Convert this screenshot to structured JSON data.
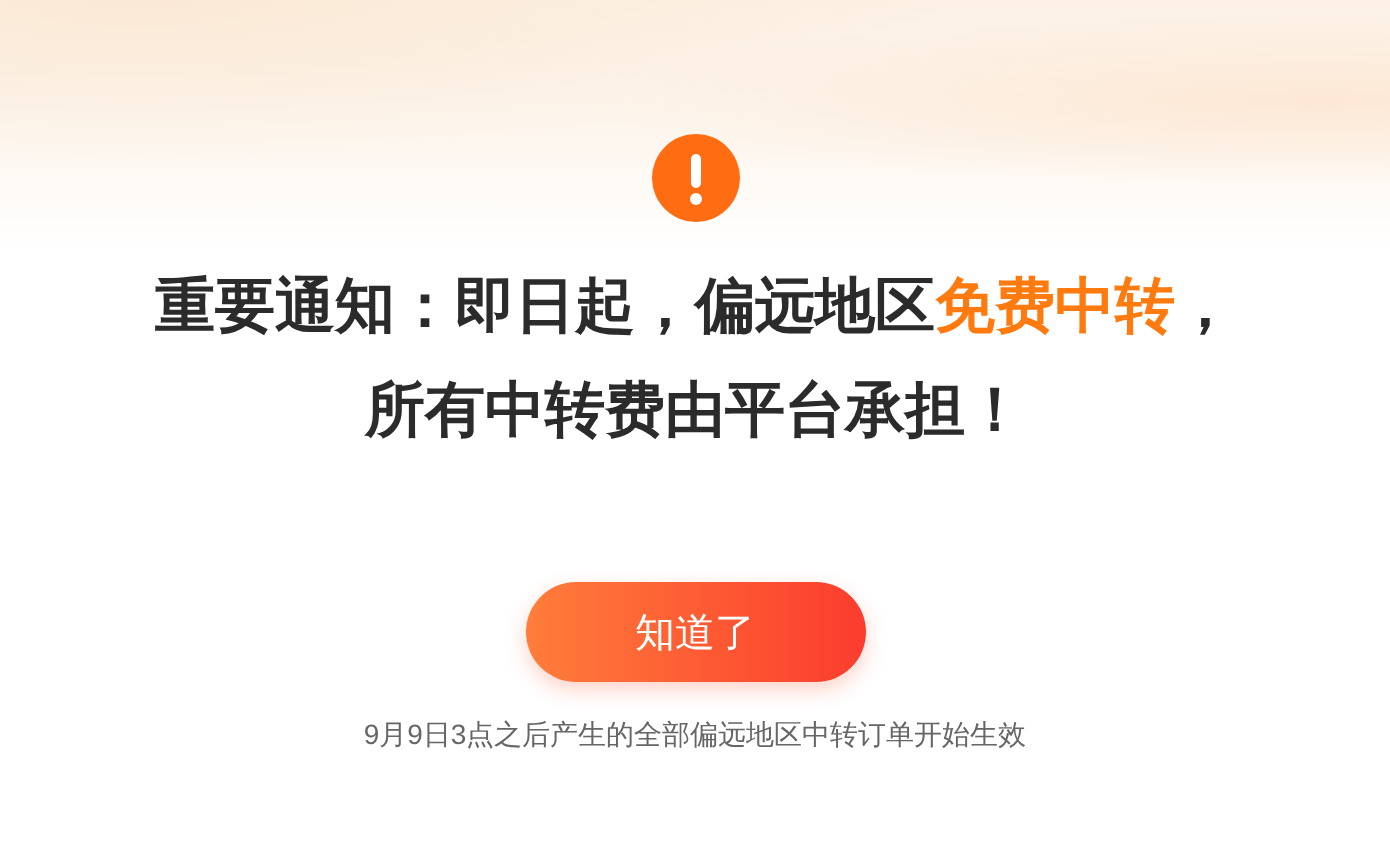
{
  "notice": {
    "title_lines": [
      [
        {
          "text": "重要通知：即日起，偏远地区",
          "highlight": false
        },
        {
          "text": "免费中转",
          "highlight": true
        },
        {
          "text": "，",
          "highlight": false
        }
      ],
      [
        {
          "text": "所有中转费由平台承担！",
          "highlight": false
        }
      ]
    ],
    "button": "知道了",
    "footnote": "9月9日3点之后产生的全部偏远地区中转订单开始生效"
  }
}
